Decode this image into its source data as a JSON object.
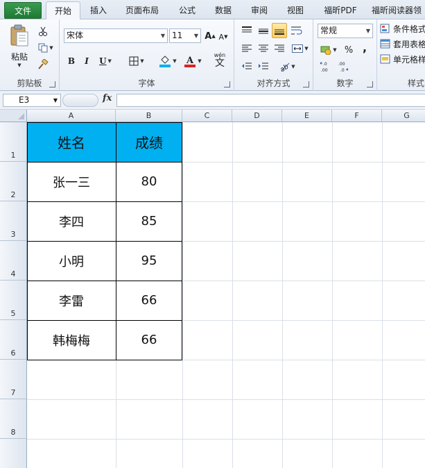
{
  "tabs": [
    {
      "label": "文件"
    },
    {
      "label": "开始"
    },
    {
      "label": "插入"
    },
    {
      "label": "页面布局"
    },
    {
      "label": "公式"
    },
    {
      "label": "数据"
    },
    {
      "label": "审阅"
    },
    {
      "label": "视图"
    },
    {
      "label": "福昕PDF"
    },
    {
      "label": "福昕阅读器领"
    }
  ],
  "ribbon": {
    "clipboard": {
      "label": "剪贴板",
      "paste": "粘贴"
    },
    "font": {
      "label": "字体",
      "name": "宋体",
      "size": "11",
      "bold": "B",
      "italic": "I",
      "underline": "U",
      "grow": "A",
      "shrink": "A",
      "phonetic": "wén",
      "phonetic_char": "文"
    },
    "alignment": {
      "label": "对齐方式"
    },
    "number": {
      "label": "数字",
      "format": "常规",
      "percent": "%",
      "comma": ","
    },
    "styles": {
      "label": "样式",
      "items": [
        "条件格式",
        "套用表格",
        "单元格样"
      ]
    }
  },
  "formula_bar": {
    "name_box": "E3",
    "fx": "fx",
    "formula": ""
  },
  "columns": [
    "A",
    "B",
    "C",
    "D",
    "E",
    "F",
    "G"
  ],
  "rows": [
    "1",
    "2",
    "3",
    "4",
    "5",
    "6",
    "7",
    "8"
  ],
  "table": {
    "headers": [
      "姓名",
      "成绩"
    ],
    "rows": [
      [
        "张一三",
        "80"
      ],
      [
        "李四",
        "85"
      ],
      [
        "小明",
        "95"
      ],
      [
        "李雷",
        "66"
      ],
      [
        "韩梅梅",
        "66"
      ]
    ]
  },
  "colors": {
    "header_fill": "#00b0f0",
    "file_tab": "#217346"
  }
}
